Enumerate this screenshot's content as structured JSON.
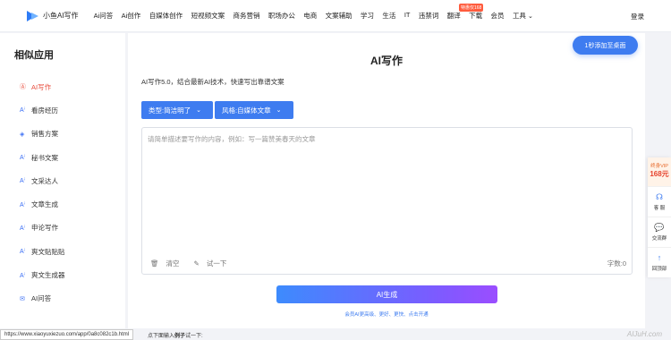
{
  "app": {
    "logo_text": "小鱼AI写作"
  },
  "nav": {
    "items": [
      "Ai问答",
      "Ai创作",
      "自媒体创作",
      "短视频文案",
      "商务营销",
      "职场办公",
      "电商",
      "文案辅助",
      "学习",
      "生活",
      "IT",
      "违禁词",
      "翻译",
      "下载",
      "会员",
      "工具"
    ],
    "hot_badge": "特惠仅168",
    "login": "登录"
  },
  "sidebar": {
    "title": "相似应用",
    "items": [
      {
        "label": "AI写作",
        "icon": "ai-circle-icon",
        "active": true
      },
      {
        "label": "看房经历",
        "icon": "ai-spark-icon"
      },
      {
        "label": "销售方案",
        "icon": "layers-icon"
      },
      {
        "label": "秘书文案",
        "icon": "ai-spark-icon"
      },
      {
        "label": "文采达人",
        "icon": "ai-spark-icon"
      },
      {
        "label": "文章生成",
        "icon": "ai-spark-icon"
      },
      {
        "label": "申论写作",
        "icon": "ai-spark-icon"
      },
      {
        "label": "爽文贴贴贴",
        "icon": "ai-spark-icon"
      },
      {
        "label": "爽文生成器",
        "icon": "ai-spark-icon"
      },
      {
        "label": "AI问答",
        "icon": "chat-icon"
      }
    ]
  },
  "main": {
    "title": "AI写作",
    "intro": "AI写作5.0，结合最新AI技术，快速写出靠谱文案",
    "chip_type": "类型:简洁明了",
    "chip_style": "风格:自媒体文章",
    "placeholder": "请简单描述要写作的内容，例如：写一篇赞美春天的文章",
    "clear": "清空",
    "try": "试一下",
    "counter": "字数:0",
    "generate": "AI生成",
    "note": "会员AI更高级、更好、更快、点击开通"
  },
  "desktop_button": "1秒添加至桌面",
  "float": {
    "vip_top": "终身VIP",
    "vip_price": "168元",
    "service": "客 服",
    "group": "交流群",
    "top": "回顶部"
  },
  "status": {
    "url": "https://www.xiaoyuxiezuo.com/app/0a8c082c1b.html",
    "hint_pre": "点下面输入",
    "hint_bold": "例子",
    "hint_post": "试一下:",
    "watermark": "AIJuH.com"
  },
  "colors": {
    "accent": "#3e7cf0",
    "active": "#e84d3d",
    "hot": "#ff5b3d"
  }
}
